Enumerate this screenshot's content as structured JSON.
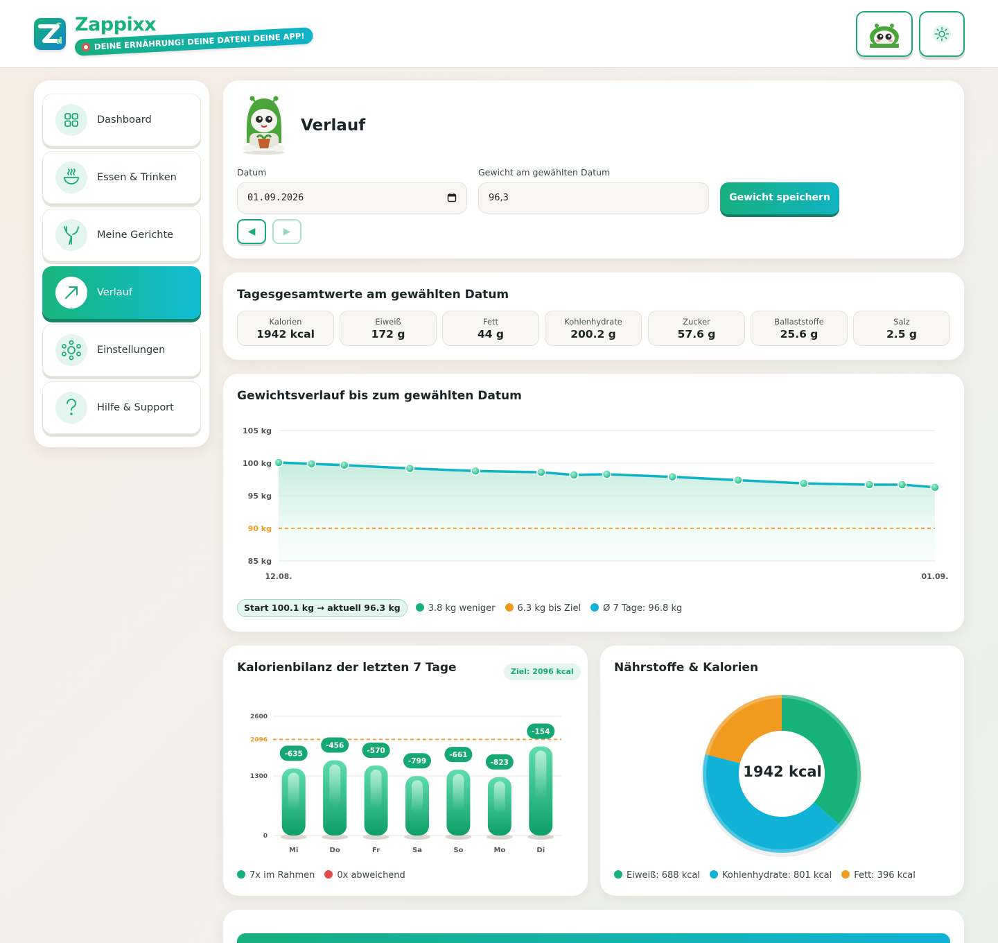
{
  "app": {
    "name": "Zappixx",
    "tagline": "DEINE ERNÄHRUNG! DEINE DATEN! DEINE APP!"
  },
  "sidebar": {
    "items": [
      {
        "label": "Dashboard",
        "icon": "grid-icon",
        "active": false
      },
      {
        "label": "Essen & Trinken",
        "icon": "bowl-icon",
        "active": false
      },
      {
        "label": "Meine Gerichte",
        "icon": "utensils-icon",
        "active": false
      },
      {
        "label": "Verlauf",
        "icon": "trend-arrow-icon",
        "active": true
      },
      {
        "label": "Einstellungen",
        "icon": "settings-icon",
        "active": false
      },
      {
        "label": "Hilfe & Support",
        "icon": "question-icon",
        "active": false
      }
    ]
  },
  "verlauf": {
    "title": "Verlauf",
    "date_label": "Datum",
    "date_value": "01.09.2026",
    "weight_label": "Gewicht am gewählten Datum",
    "weight_value": "96,3",
    "save_label": "Gewicht speichern",
    "prev_label": "◀",
    "next_label": "▶"
  },
  "totals": {
    "title": "Tagesgesamtwerte am gewählten Datum",
    "items": [
      {
        "label": "Kalorien",
        "value": "1942 kcal"
      },
      {
        "label": "Eiweiß",
        "value": "172 g"
      },
      {
        "label": "Fett",
        "value": "44 g"
      },
      {
        "label": "Kohlenhydrate",
        "value": "200.2 g"
      },
      {
        "label": "Zucker",
        "value": "57.6 g"
      },
      {
        "label": "Ballaststoffe",
        "value": "25.6 g"
      },
      {
        "label": "Salz",
        "value": "2.5 g"
      }
    ]
  },
  "weight_chart": {
    "title": "Gewichtsverlauf bis zum gewählten Datum",
    "start_pill": "Start 100.1 kg → aktuell 96.3 kg",
    "legend": [
      {
        "label": "3.8 kg weniger",
        "color": "#16b27a"
      },
      {
        "label": "6.3 kg bis Ziel",
        "color": "#f29a1f"
      },
      {
        "label": "Ø 7 Tage: 96.8 kg",
        "color": "#10b3d6"
      }
    ]
  },
  "calorie_chart": {
    "title": "Kalorienbilanz der letzten 7 Tage",
    "goal_pill": "Ziel: 2096 kcal",
    "legend": [
      {
        "label": "7x im Rahmen",
        "color": "#16b27a"
      },
      {
        "label": "0x abweichend",
        "color": "#e94848"
      }
    ]
  },
  "nutrient_chart": {
    "title": "Nährstoffe & Kalorien",
    "center": "1942 kcal",
    "legend": [
      {
        "label": "Eiweiß: 688 kcal",
        "color": "#16b27a"
      },
      {
        "label": "Kohlenhydrate: 801 kcal",
        "color": "#10b3d6"
      },
      {
        "label": "Fett: 396 kcal",
        "color": "#f29a1f"
      }
    ]
  },
  "chart_data": [
    {
      "type": "line",
      "y_ticks": [
        "105 kg",
        "100 kg",
        "95 kg",
        "90 kg",
        "85 kg"
      ],
      "ylim": [
        85,
        105
      ],
      "x_labels": [
        "12.08.",
        "01.09."
      ],
      "x_first": "2026-08-12",
      "x_last": "2026-09-01",
      "series": [
        {
          "x": [
            "2026-08-12",
            "2026-08-13",
            "2026-08-14",
            "2026-08-16",
            "2026-08-18",
            "2026-08-20",
            "2026-08-21",
            "2026-08-22",
            "2026-08-24",
            "2026-08-26",
            "2026-08-28",
            "2026-08-30",
            "2026-08-31",
            "2026-09-01"
          ],
          "values": [
            100.1,
            99.9,
            99.7,
            99.2,
            98.8,
            98.6,
            98.2,
            98.3,
            97.9,
            97.4,
            96.9,
            96.7,
            96.7,
            96.3
          ],
          "color": "#10b3c3"
        }
      ],
      "goal_line": 90,
      "goal_color": "#f29a1f",
      "grid": true
    },
    {
      "type": "bar",
      "categories": [
        "Mi",
        "Do",
        "Fr",
        "Sa",
        "So",
        "Mo",
        "Di"
      ],
      "values": [
        1461,
        1640,
        1526,
        1297,
        1435,
        1273,
        1942
      ],
      "labels": [
        "-635",
        "-456",
        "-570",
        "-799",
        "-661",
        "-823",
        "-154"
      ],
      "y_ticks": [
        "2600",
        "1300",
        "0"
      ],
      "goal_line": 2096,
      "goal_label": "2096",
      "ylim": [
        0,
        2600
      ],
      "bar_color": "#16b27a"
    },
    {
      "type": "pie",
      "slices": [
        {
          "label": "Eiweiß",
          "value": 688,
          "color": "#16b27a"
        },
        {
          "label": "Kohlenhydrate",
          "value": 801,
          "color": "#10b3d6"
        },
        {
          "label": "Fett",
          "value": 396,
          "color": "#f29a1f"
        }
      ]
    }
  ]
}
